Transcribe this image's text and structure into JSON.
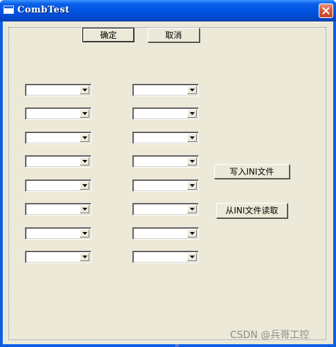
{
  "window": {
    "title": "CombTest"
  },
  "buttons": {
    "ok_label": "确定",
    "cancel_label": "取消",
    "write_ini_label": "写入INI文件",
    "read_ini_label": "从INI文件读取"
  },
  "combos": {
    "left": [
      "",
      "",
      "",
      "",
      "",
      "",
      "",
      ""
    ],
    "right": [
      "",
      "",
      "",
      "",
      "",
      "",
      "",
      ""
    ]
  },
  "watermark": "CSDN @兵哥工控",
  "colors": {
    "titlebar": "#0054e3",
    "dialog_face": "#ece9d8",
    "close_button": "#d85a3c"
  },
  "icons": {
    "window": "app-window-icon",
    "close": "close-icon",
    "dropdown": "chevron-down-icon"
  }
}
